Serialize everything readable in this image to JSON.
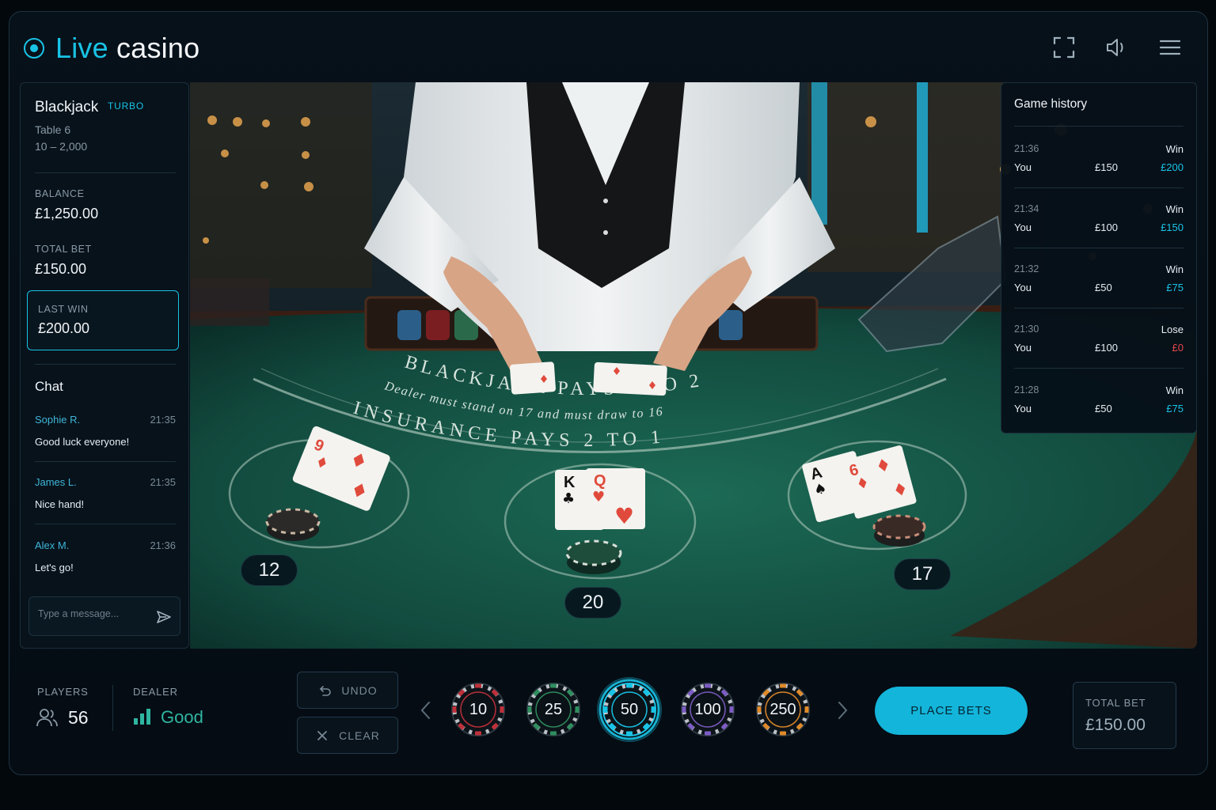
{
  "header": {
    "brand_word1": "Live",
    "brand_word2": "casino",
    "icons": [
      "fullscreen-icon",
      "volume-icon",
      "menu-icon"
    ]
  },
  "game": {
    "name": "Blackjack",
    "badge": "TURBO",
    "table": "Table 6",
    "limits": "10 – 2,000"
  },
  "stats": {
    "balance_label": "BALANCE",
    "balance_value": "£1,250.00",
    "total_bet_label": "TOTAL BET",
    "total_bet_value": "£150.00",
    "last_win_label": "LAST WIN",
    "last_win_value": "£200.00"
  },
  "chat": {
    "title": "Chat",
    "messages": [
      {
        "name": "Sophie R.",
        "time": "21:35",
        "text": "Good luck everyone!"
      },
      {
        "name": "James L.",
        "time": "21:35",
        "text": "Nice hand!"
      },
      {
        "name": "Alex M.",
        "time": "21:36",
        "text": "Let's go!"
      }
    ],
    "input_placeholder": "Type a message..."
  },
  "table_scene": {
    "description_kind": "photo",
    "felt_line1": "BLACKJACK PAYS 3 TO 2",
    "felt_line2": "Dealer must stand on 17 and must draw to 16",
    "felt_line3": "INSURANCE PAYS 2 TO 1",
    "hands": [
      {
        "seat": "left",
        "cards": [
          "9♦"
        ],
        "score": "12"
      },
      {
        "seat": "center",
        "cards": [
          "K♣",
          "Q♥"
        ],
        "score": "20"
      },
      {
        "seat": "right",
        "cards": [
          "A♠",
          "6♦"
        ],
        "score": "17"
      }
    ]
  },
  "history": {
    "title": "Game history",
    "rows": [
      {
        "time": "21:36",
        "result": "Win",
        "who": "You",
        "bet": "£150",
        "payout": "£200",
        "status": "win"
      },
      {
        "time": "21:34",
        "result": "Win",
        "who": "You",
        "bet": "£100",
        "payout": "£150",
        "status": "win"
      },
      {
        "time": "21:32",
        "result": "Win",
        "who": "You",
        "bet": "£50",
        "payout": "£75",
        "status": "win"
      },
      {
        "time": "21:30",
        "result": "Lose",
        "who": "You",
        "bet": "£100",
        "payout": "£0",
        "status": "lose"
      },
      {
        "time": "21:28",
        "result": "Win",
        "who": "You",
        "bet": "£50",
        "payout": "£75",
        "status": "win"
      }
    ]
  },
  "bottom": {
    "players_label": "PLAYERS",
    "players_value": "56",
    "dealer_label": "DEALER",
    "dealer_value": "Good",
    "undo_label": "UNDO",
    "clear_label": "CLEAR",
    "chips": [
      {
        "value": "10",
        "color": "#c0303a",
        "selected": false
      },
      {
        "value": "25",
        "color": "#2f8f5f",
        "selected": false
      },
      {
        "value": "50",
        "color": "#19c3e6",
        "selected": true
      },
      {
        "value": "100",
        "color": "#7d5cc4",
        "selected": false
      },
      {
        "value": "250",
        "color": "#e08a2a",
        "selected": false
      }
    ],
    "place_bets_label": "PLACE BETS",
    "total_bet_label": "TOTAL BET",
    "total_bet_value": "£150.00"
  },
  "colors": {
    "accent": "#19c3e6",
    "win": "#19c3e6",
    "lose": "#e5484d",
    "dealer_good": "#2fb5a0"
  }
}
